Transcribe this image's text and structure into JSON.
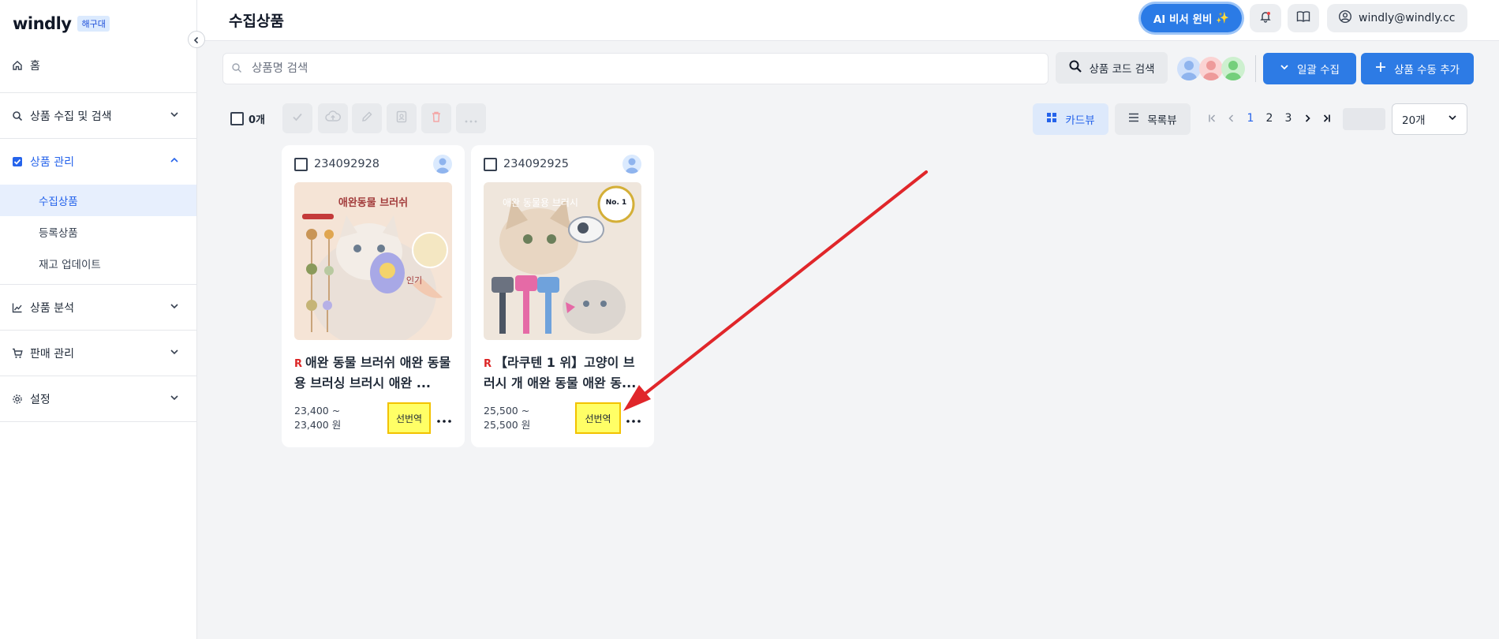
{
  "sidebar": {
    "logo": "windly",
    "badge": "해구대",
    "home": "홈",
    "groups": [
      {
        "label": "상품 수집 및 검색"
      },
      {
        "label": "상품 관리"
      },
      {
        "label": "상품 분석"
      },
      {
        "label": "판매 관리"
      },
      {
        "label": "설정"
      }
    ],
    "sub_items": [
      "수집상품",
      "등록상품",
      "재고 업데이트"
    ]
  },
  "header": {
    "title": "수집상품",
    "ai_button": "AI 비서 윈비",
    "user_email": "windly@windly.cc"
  },
  "search": {
    "placeholder": "상품명 검색",
    "code_search_button": "상품 코드 검색"
  },
  "actions": {
    "bulk_collect": "일괄 수집",
    "manual_add": "상품 수동 추가"
  },
  "toolbar": {
    "selected_count": "0개",
    "card_view": "카드뷰",
    "list_view": "목록뷰",
    "pages": [
      "1",
      "2",
      "3"
    ],
    "current_page": "1",
    "page_size": "20개"
  },
  "products": [
    {
      "id": "234092928",
      "image_text": "애완동물 브러쉬",
      "image_tag": "인기",
      "title": "애완 동물 브러쉬 애완 동물 용 브러싱 브러시 애완 ...",
      "price_line1": "23,400 ~",
      "price_line2": "23,400 원",
      "translate_button": "선번역"
    },
    {
      "id": "234092925",
      "image_text": "애완 동물용 브러시",
      "image_badge": "No. 1",
      "title": "【라쿠텐 1 위】고양이 브러시 개 애완 동물 애완 동...",
      "price_line1": "25,500 ~",
      "price_line2": "25,500 원",
      "translate_button": "선번역"
    }
  ],
  "colors": {
    "accent": "#2d7be5",
    "highlight": "#ffff66",
    "arrow": "#e0262a"
  }
}
